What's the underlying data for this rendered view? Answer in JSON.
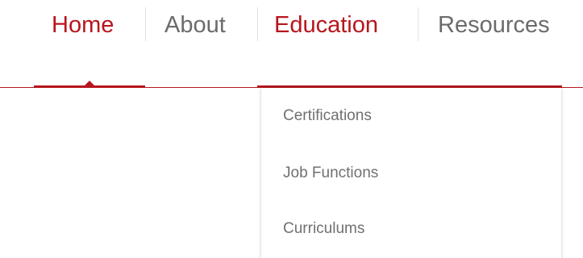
{
  "nav": {
    "items": [
      {
        "label": "Home",
        "state": "active"
      },
      {
        "label": "About",
        "state": "inactive"
      },
      {
        "label": "Education",
        "state": "active"
      },
      {
        "label": "Resources",
        "state": "inactive"
      }
    ]
  },
  "dropdown": {
    "items": [
      {
        "label": "Certifications"
      },
      {
        "label": "Job Functions"
      },
      {
        "label": "Curriculums"
      }
    ]
  },
  "colors": {
    "accent": "#b7161d",
    "nav_inactive_text": "#6b6b6b",
    "dropdown_text": "#707070",
    "separator": "#e1e1e1",
    "background": "#ffffff"
  },
  "icons": {
    "active_indicator": "caret-up-icon"
  }
}
